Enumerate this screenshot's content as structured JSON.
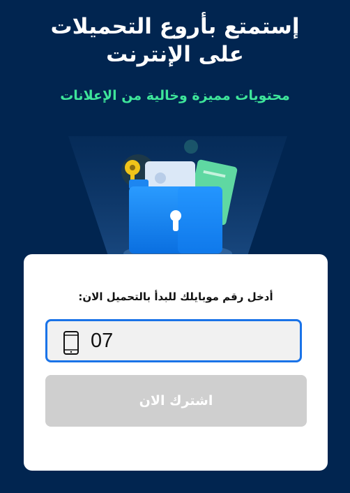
{
  "header": {
    "title_line1": "إستمتع بأروع التحميلات",
    "title_line2": "على الإنترنت",
    "subtitle": "محتويات مميزة وخالية من الإعلانات"
  },
  "hero": {
    "icons": [
      "key-icon",
      "folder-lock-icon",
      "document-icon"
    ]
  },
  "form": {
    "prompt": "أدخل رقم موبايلك للبدأ بالتحميل الان:",
    "phone_value": "07",
    "phone_icon": "mobile-phone-icon",
    "submit_label": "اشترك الان"
  },
  "colors": {
    "background": "#012550",
    "accent_green": "#3ee59a",
    "field_border": "#1a73e8",
    "button_disabled": "#cfcfcf"
  }
}
